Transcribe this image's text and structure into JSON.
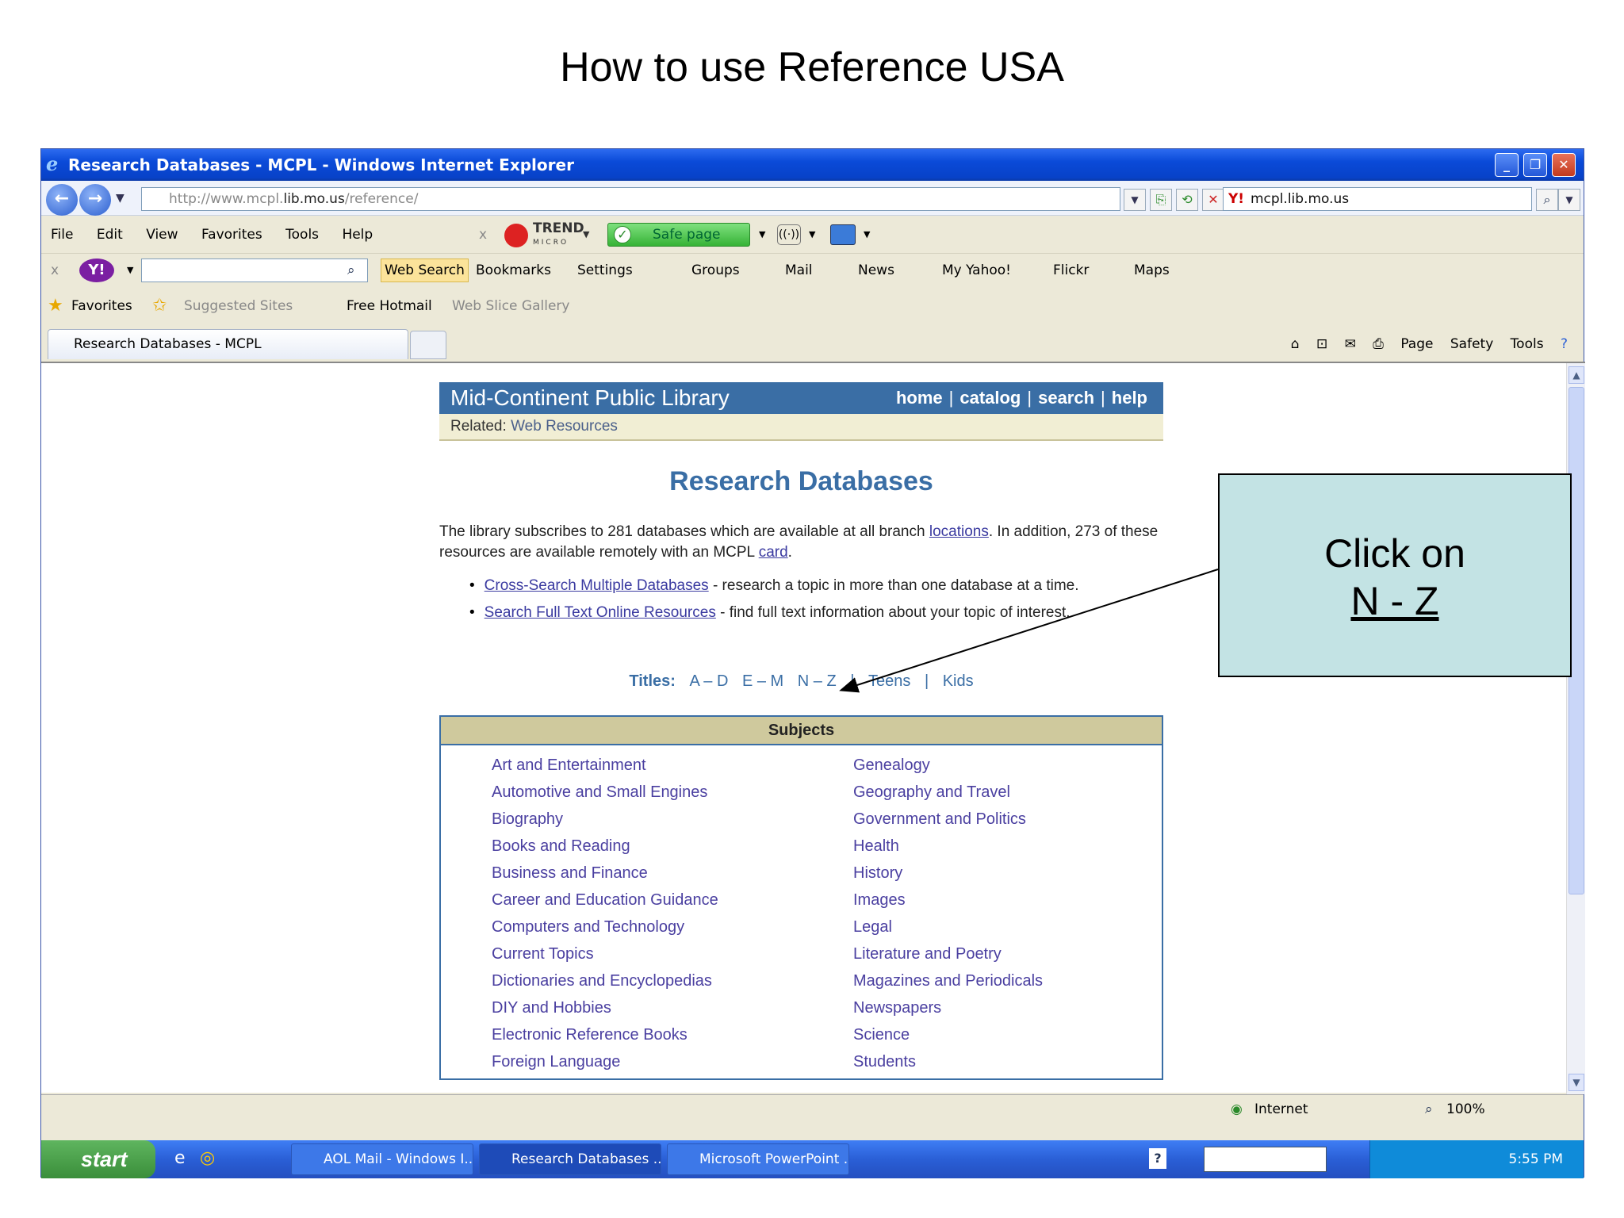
{
  "slide": {
    "title": "How to use Reference USA"
  },
  "window": {
    "title": "Research Databases - MCPL - Windows Internet Explorer"
  },
  "address": {
    "url_prefix": "http://www.mcpl.",
    "url_domain": "lib.mo.us",
    "url_path": "/reference/",
    "search_value": "mcpl.lib.mo.us"
  },
  "menu": [
    "File",
    "Edit",
    "View",
    "Favorites",
    "Tools",
    "Help"
  ],
  "trend": {
    "brand": "TREND",
    "sub": "MICRO",
    "safe": "Safe page"
  },
  "yahoo": {
    "web_search": "Web Search",
    "items": [
      "Bookmarks",
      "Settings",
      "Groups",
      "Mail",
      "News",
      "My Yahoo!",
      "Flickr",
      "Maps"
    ]
  },
  "favorites": {
    "label": "Favorites",
    "suggested": "Suggested Sites",
    "hotmail": "Free Hotmail",
    "slice": "Web Slice Gallery"
  },
  "tab": {
    "label": "Research Databases - MCPL"
  },
  "commands": {
    "page": "Page",
    "safety": "Safety",
    "tools": "Tools"
  },
  "site": {
    "name": "Mid-Continent Public Library",
    "nav": [
      "home",
      "catalog",
      "search",
      "help"
    ],
    "related_label": "Related:",
    "related_link": "Web Resources",
    "heading": "Research Databases",
    "intro_1": "The library subscribes to 281 databases which are available at all branch",
    "intro_link_1": "locations",
    "intro_2": ". In addition, 273 of these resources are available remotely with an MCPL",
    "intro_link_2": "card",
    "intro_3": ".",
    "bullet_1_link": "Cross-Search Multiple Databases",
    "bullet_1_text": " - research a topic in more than one database at a time.",
    "bullet_2_link": "Search Full Text Online Resources",
    "bullet_2_text": " - find full text information about your topic of interest.",
    "titles_label": "Titles:",
    "titles": [
      "A – D",
      "E – M",
      "N – Z"
    ],
    "teens": "Teens",
    "kids": "Kids",
    "subjects_head": "Subjects",
    "subjects_left": [
      "Art and Entertainment",
      "Automotive and Small Engines",
      "Biography",
      "Books and Reading",
      "Business and Finance",
      "Career and Education Guidance",
      "Computers and Technology",
      "Current Topics",
      "Dictionaries and Encyclopedias",
      "DIY and Hobbies",
      "Electronic Reference Books",
      "Foreign Language"
    ],
    "subjects_right": [
      "Genealogy",
      "Geography and Travel",
      "Government and Politics",
      "Health",
      "History",
      "Images",
      "Legal",
      "Literature and Poetry",
      "Magazines and Periodicals",
      "Newspapers",
      "Science",
      "Students"
    ]
  },
  "status": {
    "zone": "Internet",
    "zoom": "100%"
  },
  "taskbar": {
    "start": "start",
    "items": [
      "AOL Mail - Windows I...",
      "Research Databases ...",
      "Microsoft PowerPoint ..."
    ],
    "time": "5:55 PM"
  },
  "callout": {
    "line1": "Click on",
    "line2": "N - Z"
  },
  "colors": {
    "site_blue": "#3a6ea5",
    "callout_bg": "#c3e3e4",
    "subject_head": "#cfc99d"
  }
}
